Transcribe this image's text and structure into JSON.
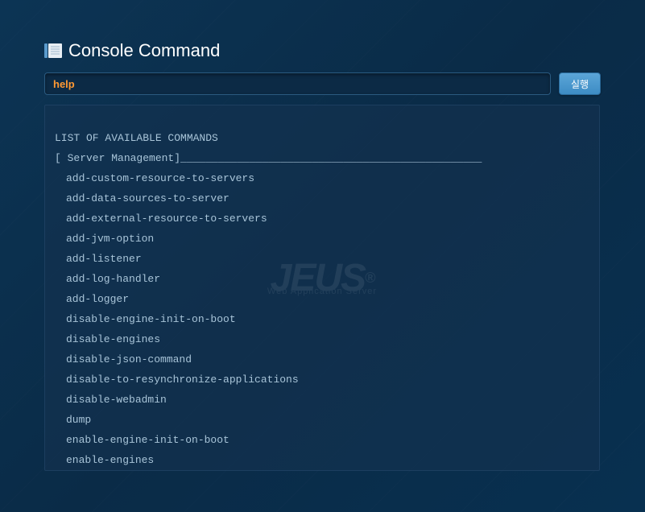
{
  "title": "Console Command",
  "input": {
    "value": "help"
  },
  "execute_button": "실행",
  "watermark": {
    "main": "JEUS",
    "sub": "Web Application Server",
    "reg": "®"
  },
  "output": {
    "header": "LIST OF AVAILABLE COMMANDS",
    "section": "[ Server Management]________________________________________________",
    "commands": [
      "add-custom-resource-to-servers",
      "add-data-sources-to-server",
      "add-external-resource-to-servers",
      "add-jvm-option",
      "add-listener",
      "add-log-handler",
      "add-logger",
      "disable-engine-init-on-boot",
      "disable-engines",
      "disable-json-command",
      "disable-to-resynchronize-applications",
      "disable-webadmin",
      "dump",
      "enable-engine-init-on-boot",
      "enable-engines"
    ]
  }
}
